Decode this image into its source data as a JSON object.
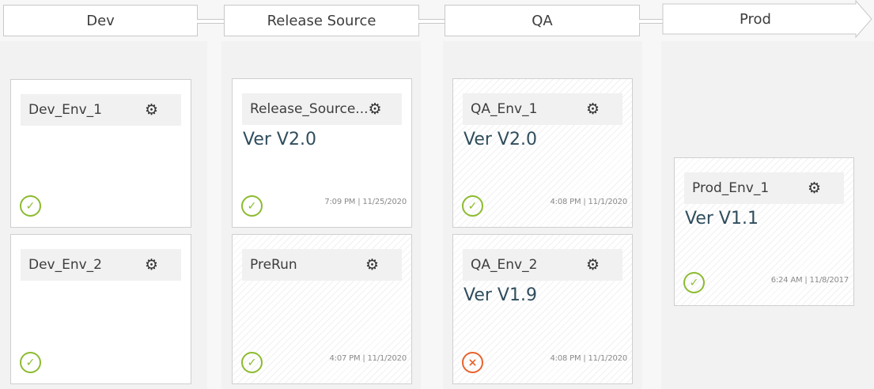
{
  "stages": [
    {
      "label": "Dev"
    },
    {
      "label": "Release Source"
    },
    {
      "label": "QA"
    },
    {
      "label": "Prod"
    }
  ],
  "environments": {
    "dev_env_1": {
      "name": "Dev_Env_1",
      "version": "",
      "status": "success",
      "status_icon": "check-circle-icon",
      "timestamp": ""
    },
    "dev_env_2": {
      "name": "Dev_Env_2",
      "version": "",
      "status": "success",
      "status_icon": "check-circle-icon",
      "timestamp": ""
    },
    "release_source": {
      "name": "Release_Source...",
      "version": "Ver V2.0",
      "status": "success",
      "status_icon": "check-circle-icon",
      "timestamp": "7:09 PM | 11/25/2020"
    },
    "prerun": {
      "name": "PreRun",
      "version": "",
      "status": "success",
      "status_icon": "check-circle-icon",
      "timestamp": "4:07 PM | 11/1/2020"
    },
    "qa_env_1": {
      "name": "QA_Env_1",
      "version": "Ver V2.0",
      "status": "success",
      "status_icon": "check-circle-icon",
      "timestamp": "4:08 PM | 11/1/2020"
    },
    "qa_env_2": {
      "name": "QA_Env_2",
      "version": "Ver V1.9",
      "status": "failure",
      "status_icon": "x-circle-icon",
      "timestamp": "4:08 PM | 11/1/2020"
    },
    "prod_env_1": {
      "name": "Prod_Env_1",
      "version": "Ver V1.1",
      "status": "success",
      "status_icon": "check-circle-icon",
      "timestamp": "6:24 AM | 11/8/2017"
    }
  },
  "icons": {
    "settings": "gear-icon",
    "menu": "hamburger-menu-icon",
    "check": "✓",
    "cross": "×"
  },
  "colors": {
    "success": "#8cbb2f",
    "failure": "#e8622c",
    "version_text": "#2f4d5c"
  }
}
